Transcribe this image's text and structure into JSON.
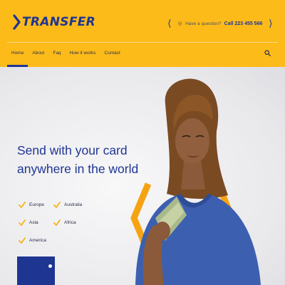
{
  "brand": {
    "name": "TRANSFER"
  },
  "contact": {
    "question": "Have a question?",
    "phone": "Call 223 455 566"
  },
  "nav": {
    "items": [
      "Home",
      "About",
      "Faq",
      "How it works",
      "Contact"
    ],
    "active": "Home"
  },
  "hero": {
    "headline_line1": "Send with your card",
    "headline_line2": "anywhere in the world",
    "countries": [
      "Europe",
      "Australia",
      "Asia",
      "Africa",
      "America"
    ]
  },
  "colors": {
    "brand_yellow": "#fdbb1a",
    "brand_blue": "#1f3592",
    "check_yellow": "#f5b418"
  },
  "icons": {
    "logo": "chevron-right-icon",
    "phone": "phone-icon",
    "search": "search-icon",
    "check": "checkmark-icon"
  }
}
